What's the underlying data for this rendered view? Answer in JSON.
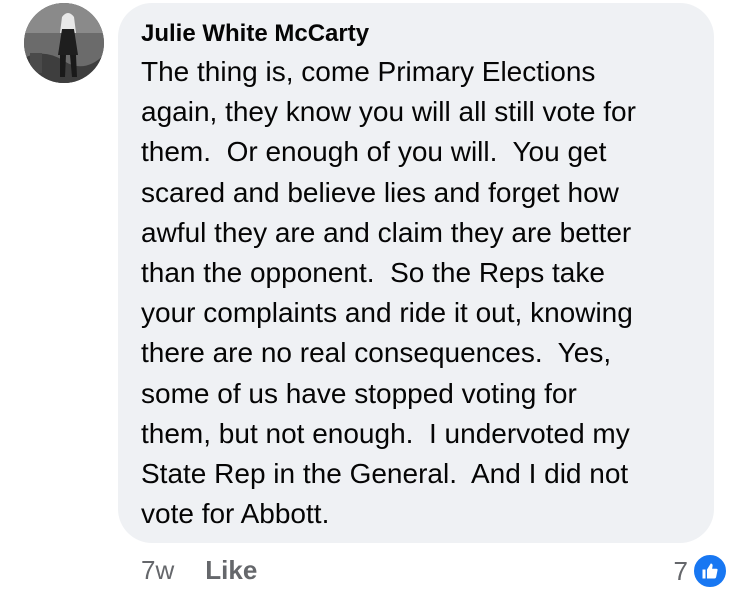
{
  "comment": {
    "author": "Julie White McCarty",
    "text_lines": [
      "The thing is, come Primary Elections",
      "again, they know you will all still vote for",
      "them.  Or enough of you will.  You get",
      "scared and believe lies and forget how",
      "awful they are and claim they are better",
      "than the opponent.  So the Reps take",
      "your complaints and ride it out, knowing",
      "there are no real consequences.  Yes,",
      "some of us have stopped voting for",
      "them, but not enough.  I undervoted my",
      "State Rep in the General.  And I did not",
      "vote for Abbott."
    ],
    "timestamp": "7w",
    "like_label": "Like",
    "reaction_count": "7"
  },
  "icons": {
    "avatar": "avatar",
    "reaction": "thumbs-up-icon"
  },
  "colors": {
    "bubble": "#eff1f4",
    "meta_text": "#65676b",
    "like_blue": "#1877f2"
  }
}
